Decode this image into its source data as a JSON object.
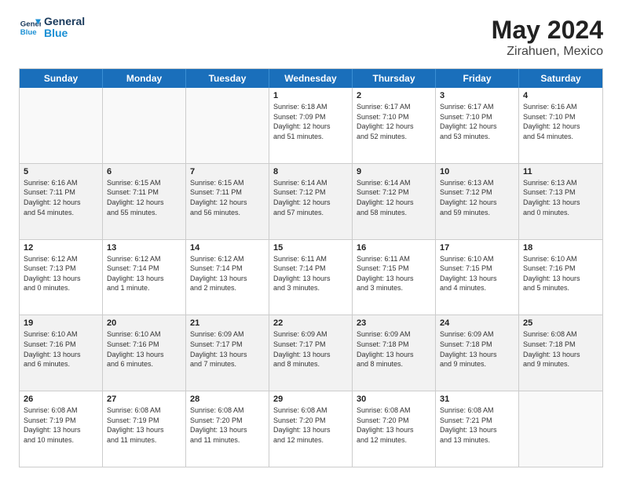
{
  "logo": {
    "line1": "General",
    "line2": "Blue"
  },
  "title": {
    "month": "May 2024",
    "location": "Zirahuen, Mexico"
  },
  "weekdays": [
    "Sunday",
    "Monday",
    "Tuesday",
    "Wednesday",
    "Thursday",
    "Friday",
    "Saturday"
  ],
  "rows": [
    {
      "alt": false,
      "cells": [
        {
          "day": "",
          "info": ""
        },
        {
          "day": "",
          "info": ""
        },
        {
          "day": "",
          "info": ""
        },
        {
          "day": "1",
          "info": "Sunrise: 6:18 AM\nSunset: 7:09 PM\nDaylight: 12 hours\nand 51 minutes."
        },
        {
          "day": "2",
          "info": "Sunrise: 6:17 AM\nSunset: 7:10 PM\nDaylight: 12 hours\nand 52 minutes."
        },
        {
          "day": "3",
          "info": "Sunrise: 6:17 AM\nSunset: 7:10 PM\nDaylight: 12 hours\nand 53 minutes."
        },
        {
          "day": "4",
          "info": "Sunrise: 6:16 AM\nSunset: 7:10 PM\nDaylight: 12 hours\nand 54 minutes."
        }
      ]
    },
    {
      "alt": true,
      "cells": [
        {
          "day": "5",
          "info": "Sunrise: 6:16 AM\nSunset: 7:11 PM\nDaylight: 12 hours\nand 54 minutes."
        },
        {
          "day": "6",
          "info": "Sunrise: 6:15 AM\nSunset: 7:11 PM\nDaylight: 12 hours\nand 55 minutes."
        },
        {
          "day": "7",
          "info": "Sunrise: 6:15 AM\nSunset: 7:11 PM\nDaylight: 12 hours\nand 56 minutes."
        },
        {
          "day": "8",
          "info": "Sunrise: 6:14 AM\nSunset: 7:12 PM\nDaylight: 12 hours\nand 57 minutes."
        },
        {
          "day": "9",
          "info": "Sunrise: 6:14 AM\nSunset: 7:12 PM\nDaylight: 12 hours\nand 58 minutes."
        },
        {
          "day": "10",
          "info": "Sunrise: 6:13 AM\nSunset: 7:12 PM\nDaylight: 12 hours\nand 59 minutes."
        },
        {
          "day": "11",
          "info": "Sunrise: 6:13 AM\nSunset: 7:13 PM\nDaylight: 13 hours\nand 0 minutes."
        }
      ]
    },
    {
      "alt": false,
      "cells": [
        {
          "day": "12",
          "info": "Sunrise: 6:12 AM\nSunset: 7:13 PM\nDaylight: 13 hours\nand 0 minutes."
        },
        {
          "day": "13",
          "info": "Sunrise: 6:12 AM\nSunset: 7:14 PM\nDaylight: 13 hours\nand 1 minute."
        },
        {
          "day": "14",
          "info": "Sunrise: 6:12 AM\nSunset: 7:14 PM\nDaylight: 13 hours\nand 2 minutes."
        },
        {
          "day": "15",
          "info": "Sunrise: 6:11 AM\nSunset: 7:14 PM\nDaylight: 13 hours\nand 3 minutes."
        },
        {
          "day": "16",
          "info": "Sunrise: 6:11 AM\nSunset: 7:15 PM\nDaylight: 13 hours\nand 3 minutes."
        },
        {
          "day": "17",
          "info": "Sunrise: 6:10 AM\nSunset: 7:15 PM\nDaylight: 13 hours\nand 4 minutes."
        },
        {
          "day": "18",
          "info": "Sunrise: 6:10 AM\nSunset: 7:16 PM\nDaylight: 13 hours\nand 5 minutes."
        }
      ]
    },
    {
      "alt": true,
      "cells": [
        {
          "day": "19",
          "info": "Sunrise: 6:10 AM\nSunset: 7:16 PM\nDaylight: 13 hours\nand 6 minutes."
        },
        {
          "day": "20",
          "info": "Sunrise: 6:10 AM\nSunset: 7:16 PM\nDaylight: 13 hours\nand 6 minutes."
        },
        {
          "day": "21",
          "info": "Sunrise: 6:09 AM\nSunset: 7:17 PM\nDaylight: 13 hours\nand 7 minutes."
        },
        {
          "day": "22",
          "info": "Sunrise: 6:09 AM\nSunset: 7:17 PM\nDaylight: 13 hours\nand 8 minutes."
        },
        {
          "day": "23",
          "info": "Sunrise: 6:09 AM\nSunset: 7:18 PM\nDaylight: 13 hours\nand 8 minutes."
        },
        {
          "day": "24",
          "info": "Sunrise: 6:09 AM\nSunset: 7:18 PM\nDaylight: 13 hours\nand 9 minutes."
        },
        {
          "day": "25",
          "info": "Sunrise: 6:08 AM\nSunset: 7:18 PM\nDaylight: 13 hours\nand 9 minutes."
        }
      ]
    },
    {
      "alt": false,
      "cells": [
        {
          "day": "26",
          "info": "Sunrise: 6:08 AM\nSunset: 7:19 PM\nDaylight: 13 hours\nand 10 minutes."
        },
        {
          "day": "27",
          "info": "Sunrise: 6:08 AM\nSunset: 7:19 PM\nDaylight: 13 hours\nand 11 minutes."
        },
        {
          "day": "28",
          "info": "Sunrise: 6:08 AM\nSunset: 7:20 PM\nDaylight: 13 hours\nand 11 minutes."
        },
        {
          "day": "29",
          "info": "Sunrise: 6:08 AM\nSunset: 7:20 PM\nDaylight: 13 hours\nand 12 minutes."
        },
        {
          "day": "30",
          "info": "Sunrise: 6:08 AM\nSunset: 7:20 PM\nDaylight: 13 hours\nand 12 minutes."
        },
        {
          "day": "31",
          "info": "Sunrise: 6:08 AM\nSunset: 7:21 PM\nDaylight: 13 hours\nand 13 minutes."
        },
        {
          "day": "",
          "info": ""
        }
      ]
    }
  ]
}
